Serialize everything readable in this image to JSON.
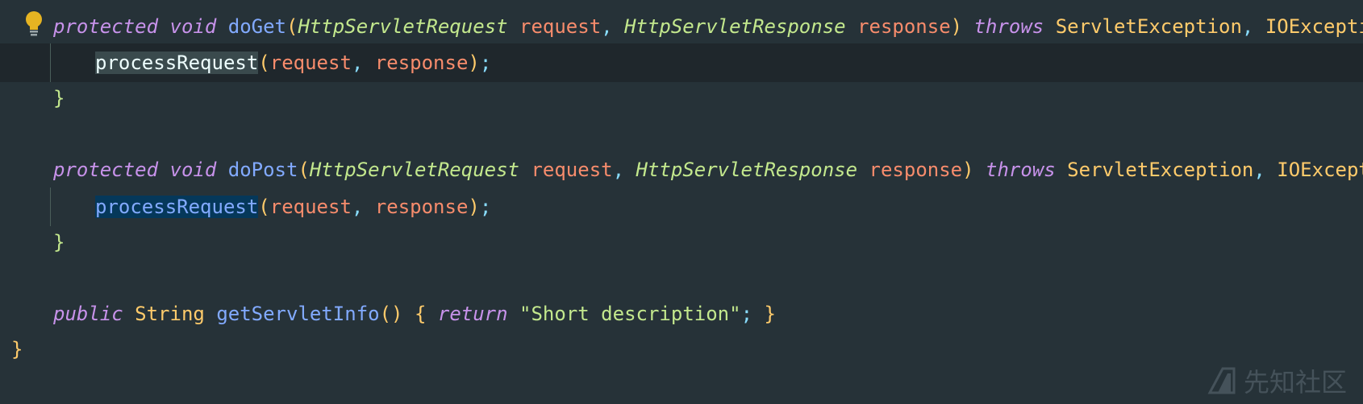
{
  "editor": {
    "lines": {
      "l1": {
        "kw1": "protected",
        "kw2": "void",
        "fn": "doGet",
        "p1": "(",
        "t1": "HttpServletRequest",
        "a1": "request",
        "c1": ",",
        "t2": "HttpServletResponse",
        "a2": "response",
        "p2": ")",
        "kw3": "throws",
        "e1": "ServletException",
        "c2": ",",
        "e2": "IOException"
      },
      "l2": {
        "call": "processRequest",
        "p1": "(",
        "a1": "request",
        "c1": ",",
        "a2": "response",
        "p2": ")",
        "semi": ";"
      },
      "l3": {
        "brace": "}"
      },
      "l5": {
        "kw1": "protected",
        "kw2": "void",
        "fn": "doPost",
        "p1": "(",
        "t1": "HttpServletRequest",
        "a1": "request",
        "c1": ",",
        "t2": "HttpServletResponse",
        "a2": "response",
        "p2": ")",
        "kw3": "throws",
        "e1": "ServletException",
        "c2": ",",
        "e2": "IOExceptio"
      },
      "l6": {
        "call": "processRequest",
        "p1": "(",
        "a1": "request",
        "c1": ",",
        "a2": "response",
        "p2": ")",
        "semi": ";"
      },
      "l7": {
        "brace": "}"
      },
      "l9": {
        "kw1": "public",
        "type": "String",
        "fn": "getServletInfo",
        "parens": "()",
        "ob": "{",
        "kw2": "return",
        "str": "\"Short description\"",
        "semi": ";",
        "cb": "}"
      },
      "l10": {
        "brace": "}"
      }
    }
  },
  "watermark": {
    "text": "先知社区",
    "logo_icon": "xianzhi-logo-icon"
  },
  "gutter": {
    "bulb_icon": "lightbulb-icon"
  },
  "colors": {
    "background": "#263238",
    "current_line": "#1f272c",
    "keyword": "#c792ea",
    "function": "#82aaff",
    "type_param": "#c3e88d",
    "type": "#ffcb6b",
    "parameter": "#f78c6c",
    "selection": "#05385a"
  }
}
